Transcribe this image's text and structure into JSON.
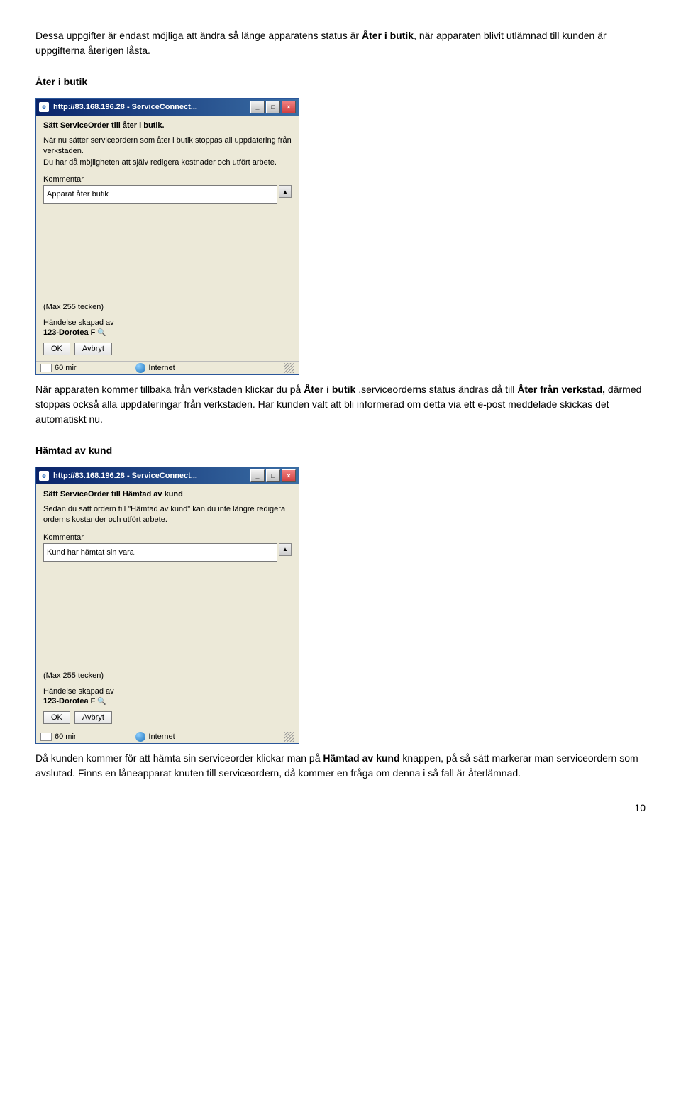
{
  "intro_text": "Dessa uppgifter är endast möjliga att ändra så länge apparatens status är ",
  "intro_bold": "Åter i butik",
  "intro_cont": ", när apparaten blivit utlämnad till kunden är uppgifterna återigen låsta.",
  "section1_title": "Åter i butik",
  "dialog1": {
    "titlebar": "http://83.168.196.28 - ServiceConnect...",
    "heading": "Sätt ServiceOrder till åter i butik.",
    "desc1": "När nu sätter serviceordern som åter i butik stoppas all uppdatering från verkstaden.",
    "desc2": "Du har då möjligheten att själv redigera kostnader och utfört arbete.",
    "kommentar_label": "Kommentar",
    "kommentar_value": "Apparat åter butik",
    "maxchars": "(Max 255 tecken)",
    "created_label": "Händelse skapad av",
    "created_name": "123-Dorotea F",
    "ok": "OK",
    "cancel": "Avbryt",
    "status_left": "60 mir",
    "status_center": "Internet"
  },
  "para1_pre": "När apparaten kommer tillbaka från verkstaden klickar du på ",
  "para1_b1": "Åter i butik",
  "para1_mid": " ,serviceorderns status ändras då till ",
  "para1_b2": "Åter från verkstad,",
  "para1_post": " därmed stoppas också alla uppdateringar från verkstaden. Har kunden valt att bli informerad om detta via ett e-post meddelade skickas det automatiskt nu.",
  "section2_title": "Hämtad av kund",
  "dialog2": {
    "titlebar": "http://83.168.196.28 - ServiceConnect...",
    "heading": "Sätt ServiceOrder till Hämtad av kund",
    "desc1": "Sedan du satt ordern till \"Hämtad av kund\" kan du inte längre redigera orderns kostander och utfört arbete.",
    "kommentar_label": "Kommentar",
    "kommentar_value": "Kund har hämtat sin vara.",
    "maxchars": "(Max 255 tecken)",
    "created_label": "Händelse skapad av",
    "created_name": "123-Dorotea F",
    "ok": "OK",
    "cancel": "Avbryt",
    "status_left": "60 mir",
    "status_center": "Internet"
  },
  "para2_pre": "Då kunden kommer för att hämta sin serviceorder klickar man på ",
  "para2_b1": "Hämtad av kund",
  "para2_post": " knappen, på så sätt markerar man serviceordern som avslutad. Finns en låneapparat knuten till serviceordern, då kommer en fråga om denna i så fall är återlämnad.",
  "page_number": "10"
}
